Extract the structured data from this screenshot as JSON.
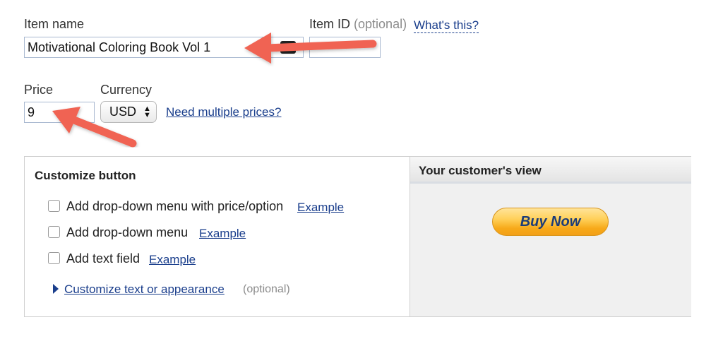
{
  "item_name": {
    "label": "Item name",
    "value": "Motivational Coloring Book Vol 1"
  },
  "item_id": {
    "label": "Item ID",
    "optional": "(optional)",
    "help_link": "What's this?",
    "value": ""
  },
  "price": {
    "label": "Price",
    "value": "9"
  },
  "currency": {
    "label": "Currency",
    "selected": "USD",
    "multi_link": "Need multiple prices?"
  },
  "customize": {
    "title": "Customize button",
    "options": [
      {
        "label": "Add drop-down menu with price/option",
        "example": "Example"
      },
      {
        "label": "Add drop-down menu",
        "example": "Example"
      },
      {
        "label": "Add text field",
        "example": "Example"
      }
    ],
    "expand_link": "Customize text or appearance",
    "expand_optional": "(optional)"
  },
  "preview": {
    "title": "Your customer's view",
    "button_label": "Buy Now"
  },
  "colors": {
    "arrow": "#f06452",
    "link": "#1a3e8c",
    "button": "#ffc83d"
  }
}
